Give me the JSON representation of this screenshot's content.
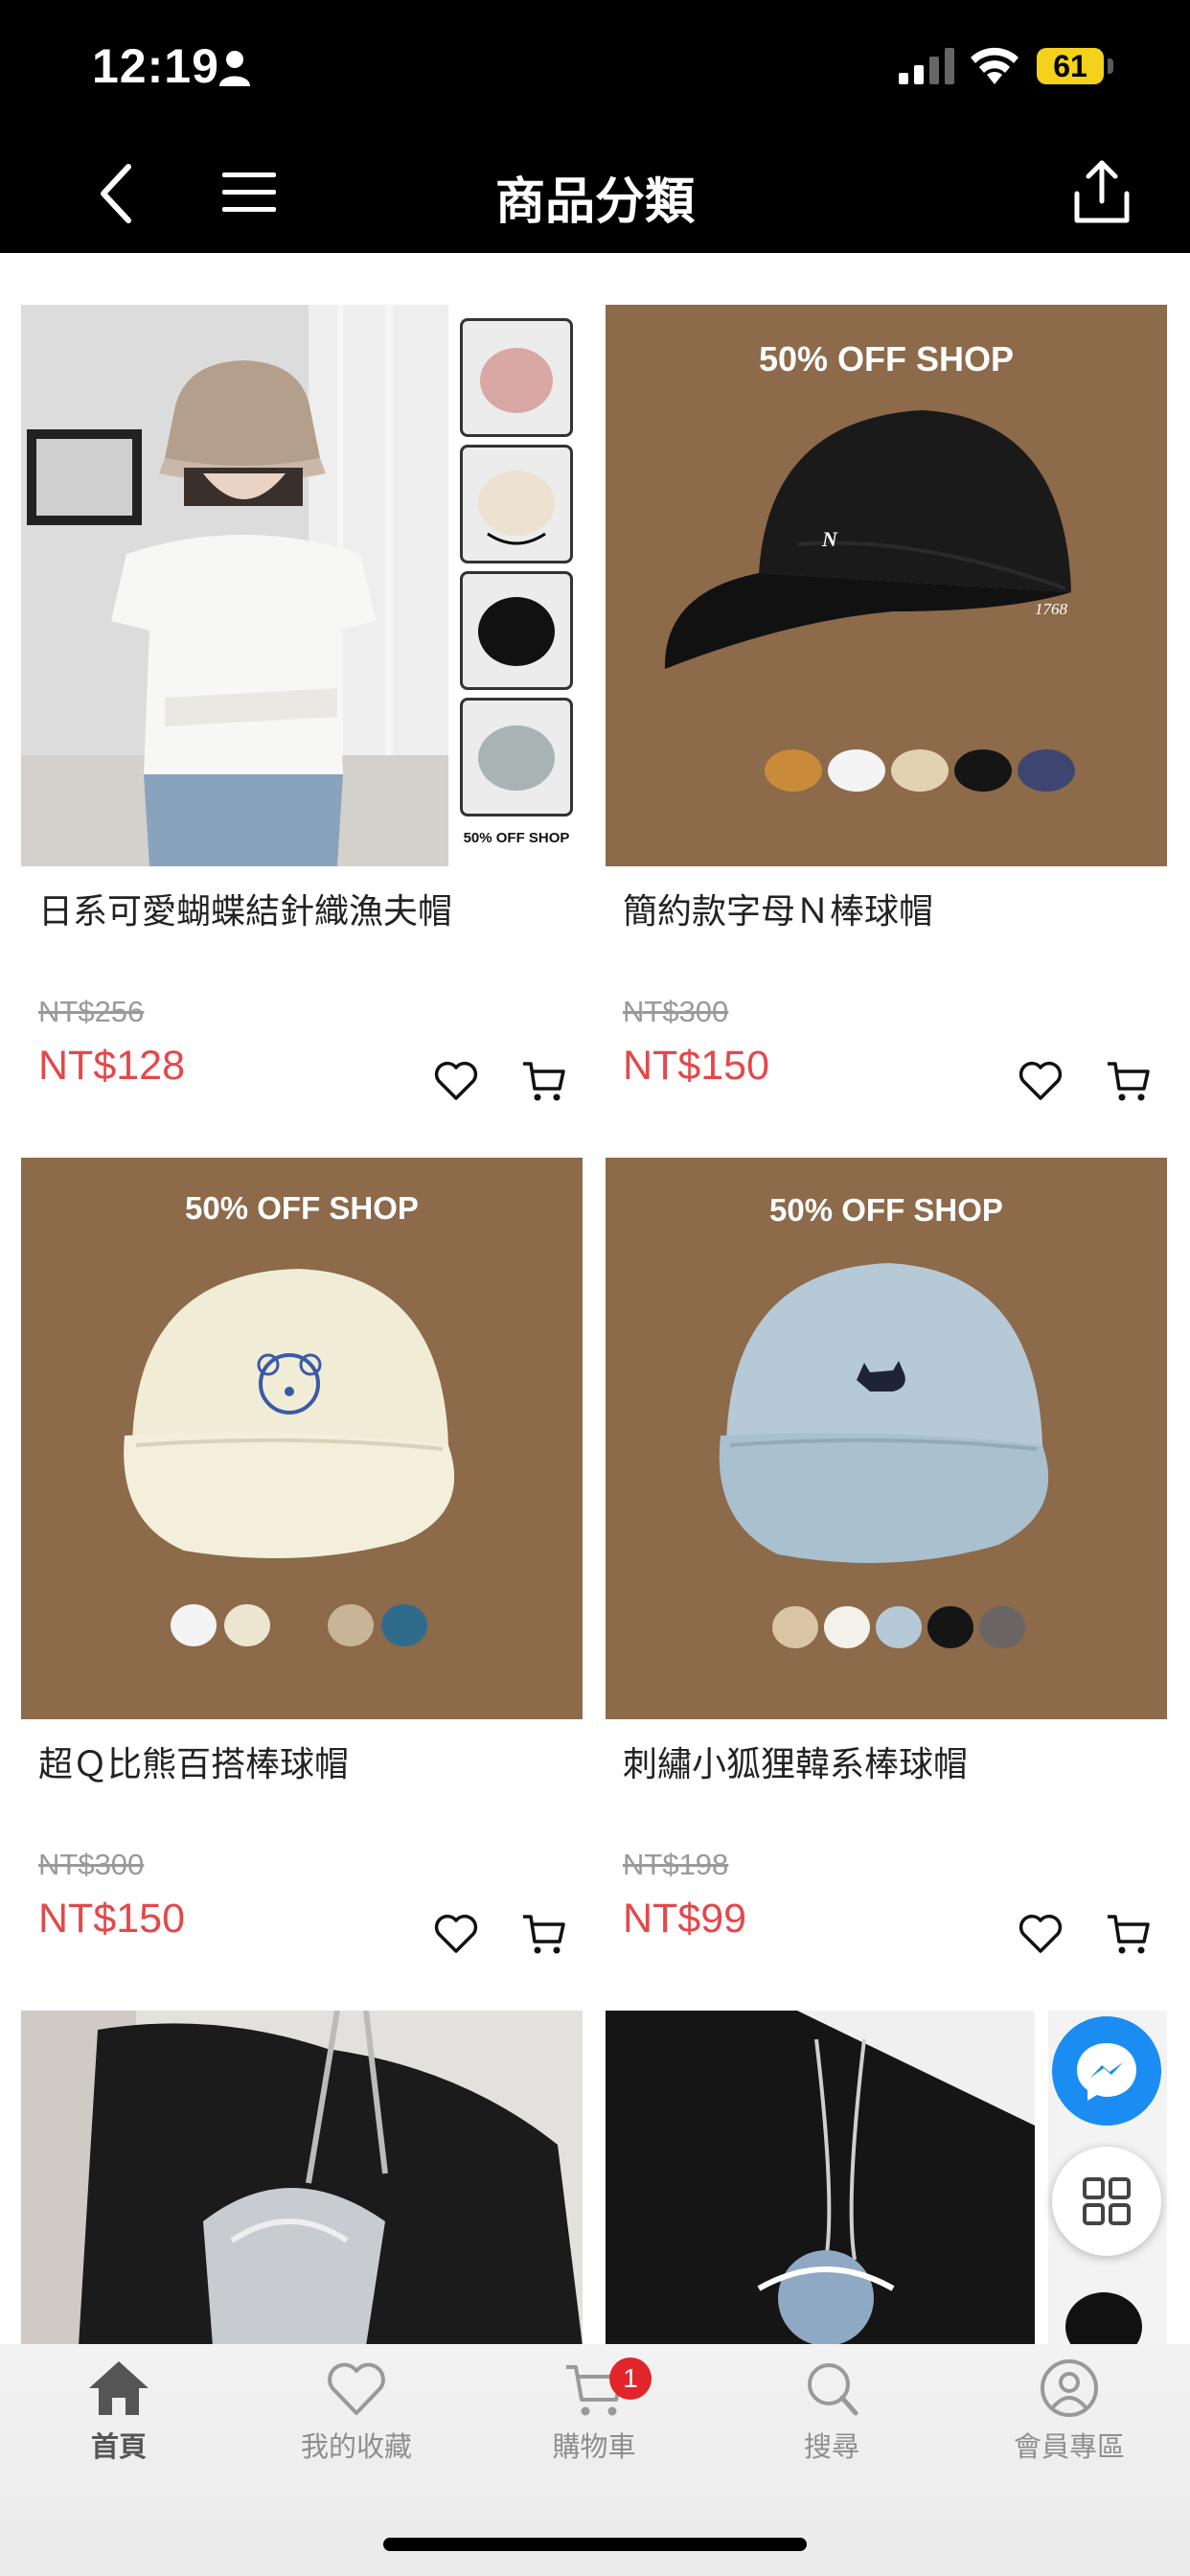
{
  "status_bar": {
    "time": "12:19",
    "battery": "61"
  },
  "header": {
    "title": "商品分類"
  },
  "products": [
    {
      "name": "日系可愛蝴蝶結針織漁夫帽",
      "original_price": "NT$256",
      "sale_price": "NT$128",
      "image_caption": "50% OFF SHOP"
    },
    {
      "name": "簡約款字母Ｎ棒球帽",
      "original_price": "NT$300",
      "sale_price": "NT$150",
      "image_caption": "50% OFF SHOP",
      "image_mark": "1768"
    },
    {
      "name": "超Ｑ比熊百搭棒球帽",
      "original_price": "NT$300",
      "sale_price": "NT$150",
      "image_caption": "50% OFF SHOP"
    },
    {
      "name": "刺繡小狐狸韓系棒球帽",
      "original_price": "NT$198",
      "sale_price": "NT$99",
      "image_caption": "50% OFF SHOP"
    }
  ],
  "tab_bar": {
    "items": [
      {
        "label": "首頁",
        "icon": "home-icon",
        "active": true
      },
      {
        "label": "我的收藏",
        "icon": "heart-icon",
        "active": false
      },
      {
        "label": "購物車",
        "icon": "cart-icon",
        "active": false,
        "badge": "1"
      },
      {
        "label": "搜尋",
        "icon": "search-icon",
        "active": false
      },
      {
        "label": "會員專區",
        "icon": "user-icon",
        "active": false
      }
    ]
  },
  "colors": {
    "accent_price": "#e4484a",
    "header_bg": "#000000",
    "product_bg_brown": "#8c6a4a",
    "messenger_blue": "#1a8cf2",
    "badge_red": "#e0262b"
  }
}
